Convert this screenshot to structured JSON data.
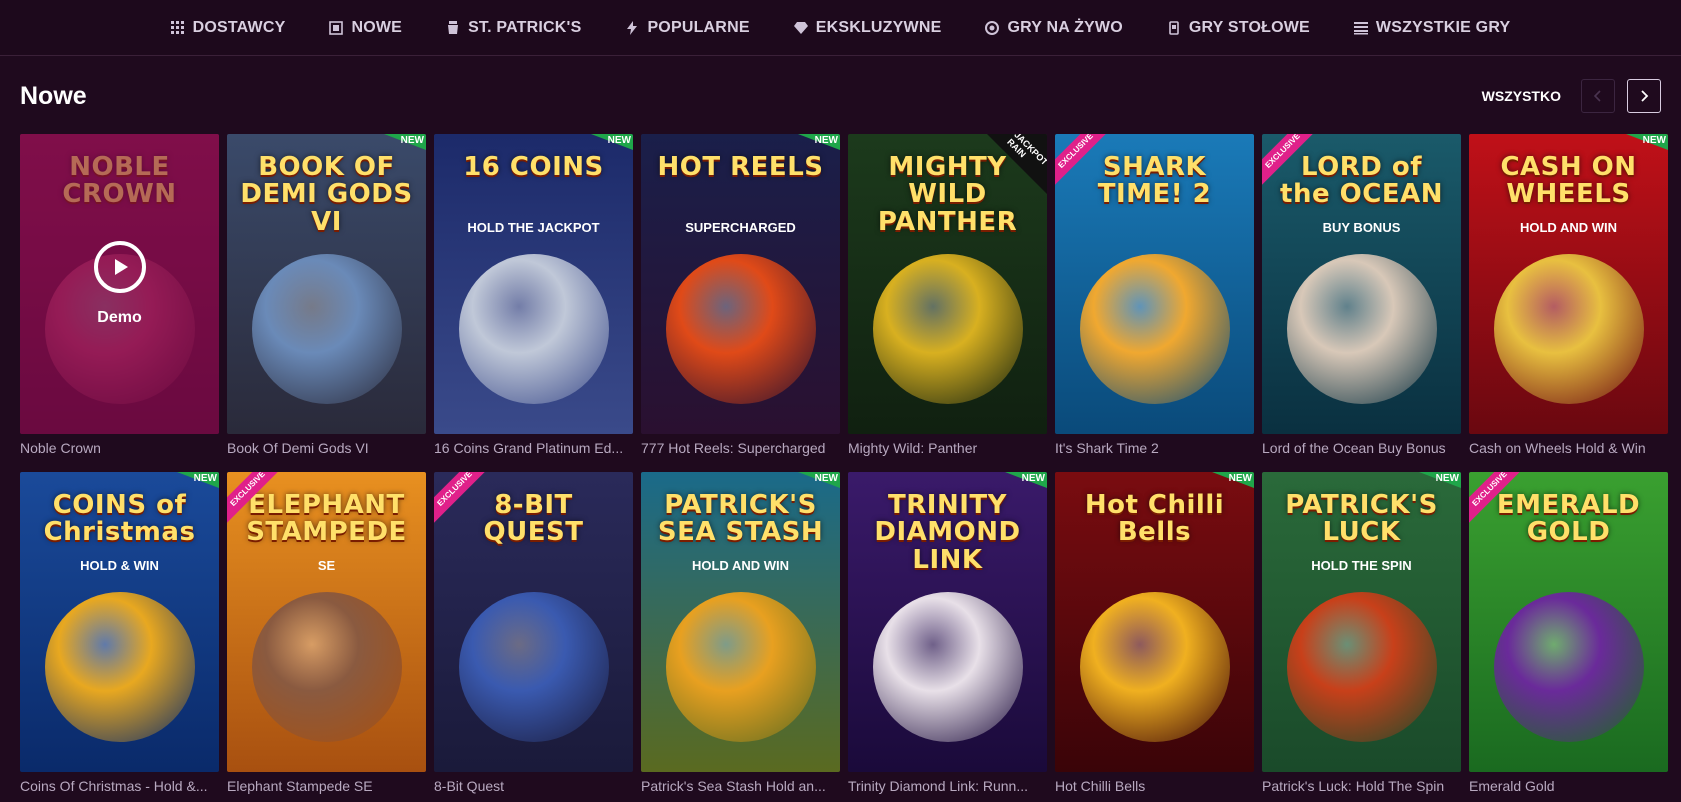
{
  "nav": [
    {
      "label": "DOSTAWCY",
      "icon": "grid-icon"
    },
    {
      "label": "NOWE",
      "icon": "new-icon"
    },
    {
      "label": "ST. PATRICK'S",
      "icon": "pot-icon"
    },
    {
      "label": "POPULARNE",
      "icon": "lightning-icon"
    },
    {
      "label": "EKSKLUZYWNE",
      "icon": "diamond-icon"
    },
    {
      "label": "GRY NA ŻYWO",
      "icon": "chip-icon"
    },
    {
      "label": "GRY STOŁOWE",
      "icon": "cards-icon"
    },
    {
      "label": "WSZYSTKIE GRY",
      "icon": "list-icon"
    }
  ],
  "section": {
    "title": "Nowe",
    "see_all": "WSZYSTKO"
  },
  "badges": {
    "new": "NEW",
    "exclusive": "EXCLUSIVE",
    "jackpot": "JACKPOT RAIN"
  },
  "demo_label": "Demo",
  "games": [
    {
      "name": "Noble Crown",
      "thumb_title": "NOBLE CROWN",
      "thumb_sub": "",
      "badge": "",
      "demo": true,
      "bg1": "#8a1450",
      "bg2": "#5a0c3a",
      "art": "#b8326a"
    },
    {
      "name": "Book Of Demi Gods VI",
      "thumb_title": "BOOK OF DEMI GODS VI",
      "thumb_sub": "",
      "badge": "new",
      "demo": false,
      "bg1": "#3a4a6a",
      "bg2": "#2a2a3a",
      "art": "#6a8ab8"
    },
    {
      "name": "16 Coins Grand Platinum Ed...",
      "thumb_title": "16 COINS",
      "thumb_sub": "HOLD THE JACKPOT",
      "badge": "new",
      "demo": false,
      "bg1": "#1c2a6a",
      "bg2": "#3a4a8a",
      "art": "#c0c8d8"
    },
    {
      "name": "777 Hot Reels: Supercharged",
      "thumb_title": "HOT REELS",
      "thumb_sub": "SUPERCHARGED",
      "badge": "new",
      "demo": false,
      "bg1": "#1a1f4a",
      "bg2": "#2a1030",
      "art": "#e04a18"
    },
    {
      "name": "Mighty Wild: Panther",
      "thumb_title": "MIGHTY WILD PANTHER",
      "thumb_sub": "",
      "badge": "jackpot",
      "demo": false,
      "bg1": "#1c3a1c",
      "bg2": "#102010",
      "art": "#d8b020"
    },
    {
      "name": "It's Shark Time 2",
      "thumb_title": "SHARK TIME! 2",
      "thumb_sub": "",
      "badge": "exclusive",
      "demo": false,
      "bg1": "#1a7ab8",
      "bg2": "#0a4a7a",
      "art": "#f0a830"
    },
    {
      "name": "Lord of the Ocean Buy Bonus",
      "thumb_title": "LORD of the OCEAN",
      "thumb_sub": "BUY BONUS",
      "badge": "exclusive",
      "demo": false,
      "bg1": "#1a5a6a",
      "bg2": "#0a3040",
      "art": "#d8c8b8"
    },
    {
      "name": "Cash on Wheels Hold & Win",
      "thumb_title": "CASH ON WHEELS",
      "thumb_sub": "HOLD AND WIN",
      "badge": "new",
      "demo": false,
      "bg1": "#c01018",
      "bg2": "#6a0810",
      "art": "#e8c040"
    },
    {
      "name": "Coins Of Christmas - Hold &...",
      "thumb_title": "COINS of Christmas",
      "thumb_sub": "HOLD & WIN",
      "badge": "new",
      "demo": false,
      "bg1": "#1a4a9a",
      "bg2": "#0a2a6a",
      "art": "#e8a820"
    },
    {
      "name": "Elephant Stampede SE",
      "thumb_title": "ELEPHANT STAMPEDE",
      "thumb_sub": "SE",
      "badge": "exclusive",
      "demo": false,
      "bg1": "#e89020",
      "bg2": "#a85010",
      "art": "#8a5a40"
    },
    {
      "name": "8-Bit Quest",
      "thumb_title": "8-BIT QUEST",
      "thumb_sub": "",
      "badge": "exclusive",
      "demo": false,
      "bg1": "#2a2a5a",
      "bg2": "#1a1a3a",
      "art": "#3a5ab0"
    },
    {
      "name": "Patrick's Sea Stash Hold an...",
      "thumb_title": "PATRICK'S SEA STASH",
      "thumb_sub": "HOLD AND WIN",
      "badge": "new",
      "demo": false,
      "bg1": "#1a6a8a",
      "bg2": "#5a6a20",
      "art": "#e8a020"
    },
    {
      "name": "Trinity Diamond Link: Runn...",
      "thumb_title": "TRINITY DIAMOND LINK",
      "thumb_sub": "",
      "badge": "new",
      "demo": false,
      "bg1": "#3a1a6a",
      "bg2": "#1a0a3a",
      "art": "#e8e0e8"
    },
    {
      "name": "Hot Chilli Bells",
      "thumb_title": "Hot Chilli Bells",
      "thumb_sub": "",
      "badge": "new",
      "demo": false,
      "bg1": "#7a0c10",
      "bg2": "#3a0408",
      "art": "#f0b020"
    },
    {
      "name": "Patrick's Luck: Hold The Spin",
      "thumb_title": "PATRICK'S LUCK",
      "thumb_sub": "HOLD THE SPIN",
      "badge": "new",
      "demo": false,
      "bg1": "#2a6a3a",
      "bg2": "#1a4a2a",
      "art": "#c8401a"
    },
    {
      "name": "Emerald Gold",
      "thumb_title": "EMERALD GOLD",
      "thumb_sub": "",
      "badge": "exclusive",
      "demo": false,
      "bg1": "#3aa030",
      "bg2": "#1a6a20",
      "art": "#6a2a9a"
    }
  ]
}
